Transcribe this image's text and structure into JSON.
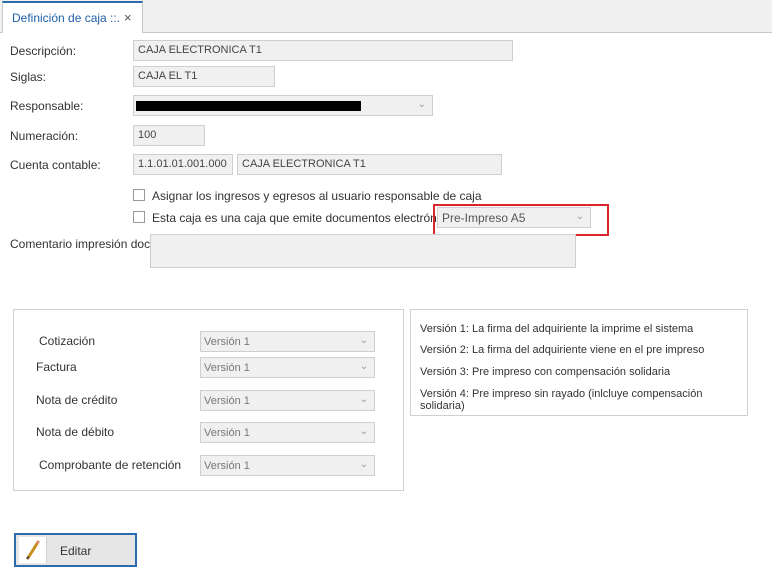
{
  "tab": {
    "title": "Definición de caja ::.",
    "close": "×"
  },
  "form": {
    "descripcion_label": "Descripción:",
    "descripcion_value": "CAJA ELECTRONICA T1",
    "siglas_label": "Siglas:",
    "siglas_value": "CAJA EL T1",
    "responsable_label": "Responsable:",
    "numeracion_label": "Numeración:",
    "numeracion_value": "100",
    "cuenta_label": "Cuenta contable:",
    "cuenta_code": "1.1.01.01.001.000",
    "cuenta_name": "CAJA ELECTRONICA T1",
    "check_asignar": "Asignar los ingresos y egresos al usuario responsable de caja",
    "check_electronica": "Esta caja es una caja que emite documentos electrónicos",
    "formato_value": "Pre-Impreso A5",
    "comentario_label": "Comentario impresión docs:"
  },
  "versiones": {
    "rows": [
      {
        "label": "Cotización",
        "value": "Versión 1"
      },
      {
        "label": "Factura",
        "value": "Versión 1"
      },
      {
        "label": "Nota de crédito",
        "value": "Versión 1"
      },
      {
        "label": "Nota de débito",
        "value": "Versión 1"
      },
      {
        "label": "Comprobante de retención",
        "value": "Versión 1"
      }
    ]
  },
  "info": {
    "lines": [
      "Versión 1: La firma del adquiriente la imprime el sistema",
      "Versión 2:  La firma del adquiriente viene en el pre impreso",
      "Versión 3: Pre impreso con compensación solidaria",
      "Versión 4: Pre impreso sin rayado (inlcluye compensación solidaria)"
    ]
  },
  "toolbar": {
    "edit_label": "Editar"
  },
  "colors": {
    "accent": "#2b6cb0",
    "highlight": "#d9262c",
    "field_bg": "#f0f0f0"
  }
}
